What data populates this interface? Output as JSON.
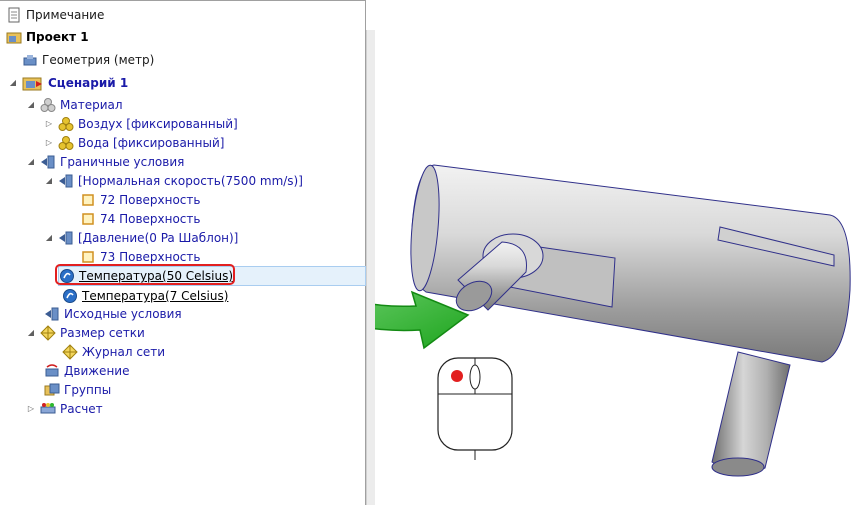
{
  "tree": {
    "note": "Примечание",
    "project": "Проект 1",
    "geometry": "Геометрия (метр)",
    "scenario": "Сценарий 1",
    "material": "Материал",
    "air": "Воздух [фиксированный]",
    "water": "Вода [фиксированный]",
    "boundary": "Граничные условия",
    "normal_velocity": "[Нормальная скорость(7500 mm/s)]",
    "surface72": "72 Поверхность",
    "surface74": "74 Поверхность",
    "pressure": "[Давление(0 Pa Шаблон)]",
    "surface73": "73 Поверхность",
    "temp50": "Температура(50 Celsius)",
    "temp7": "Температура(7 Celsius)",
    "initial": "Исходные условия",
    "mesh_size": "Размер сетки",
    "mesh_log": "Журнал сети",
    "motion": "Движение",
    "groups": "Группы",
    "calc": "Расчет"
  },
  "colors": {
    "highlight": "#e21f1f",
    "arrow": "#2db82d",
    "selection": "#e5f1fb",
    "link": "#1a1aa8"
  },
  "icons": [
    "note-icon",
    "project-icon",
    "geometry-icon",
    "scenario-icon",
    "material-icon",
    "boundary-icon",
    "surface-icon",
    "temperature-icon",
    "mesh-icon",
    "motion-icon",
    "groups-icon",
    "calc-icon",
    "mouse-left-click-icon"
  ]
}
